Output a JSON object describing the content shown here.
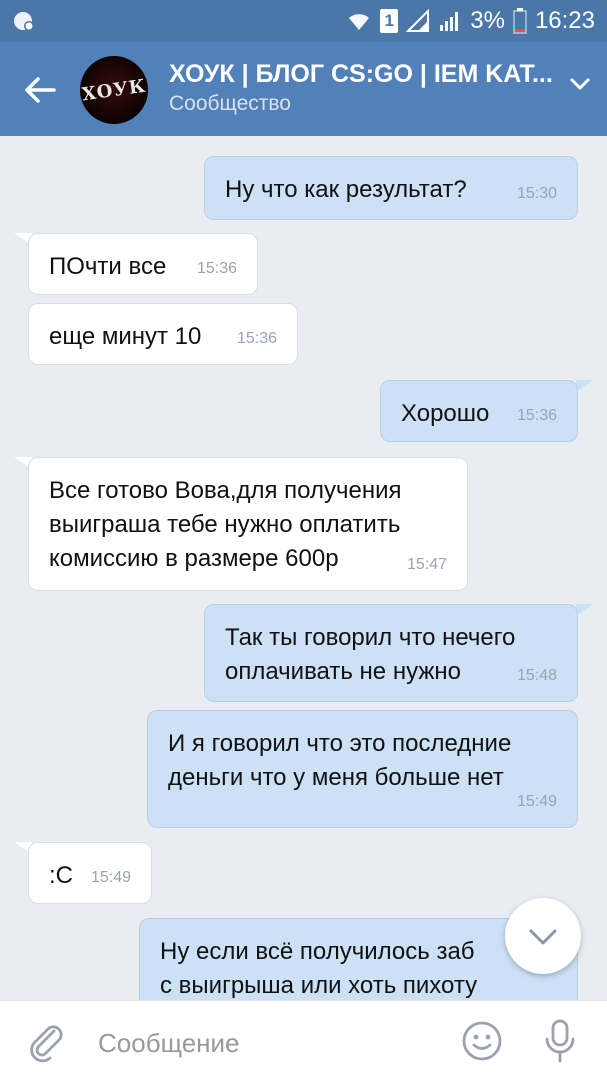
{
  "status_bar": {
    "sim_label": "1",
    "battery": "3%",
    "time": "16:23"
  },
  "header": {
    "title": "ХОУК | БЛОГ CS:GO | IEM KAT...",
    "subtitle": "Сообщество",
    "avatar_text": "ХОУК"
  },
  "messages": [
    {
      "dir": "out",
      "text": "Ну что как результат?",
      "time": "15:30"
    },
    {
      "dir": "in",
      "text": "ПОчти все",
      "time": "15:36"
    },
    {
      "dir": "in",
      "text": "еще минут 10",
      "time": "15:36"
    },
    {
      "dir": "out",
      "text": "Хорошо",
      "time": "15:36"
    },
    {
      "dir": "in",
      "lines": [
        "Все готово Вова,для получения",
        "выиграша тебе нужно оплатить",
        "комиссию в размере 600р"
      ],
      "time": "15:47"
    },
    {
      "dir": "out",
      "lines": [
        "Так ты говорил что нечего",
        "оплачивать не нужно"
      ],
      "time": "15:48"
    },
    {
      "dir": "out",
      "lines": [
        "И я говорил что это последние",
        "деньги что у меня больше нет"
      ],
      "time": "15:49"
    },
    {
      "dir": "in",
      "text": ":С",
      "time": "15:49"
    },
    {
      "dir": "out",
      "lines": [
        "Ну если всё получилось заб",
        "с выигрыша или хоть пихоту"
      ],
      "time": ""
    }
  ],
  "composer": {
    "placeholder": "Сообщение"
  },
  "icons": {
    "back": "back-arrow-icon",
    "chevron": "chevron-down-icon",
    "attach": "paperclip-icon",
    "emoji": "smiley-icon",
    "mic": "microphone-icon",
    "scroll": "chevron-down-icon"
  },
  "colors": {
    "header": "#5181b8",
    "statusbar": "#4a76a8",
    "chat_bg": "#e9edf2",
    "bubble_in": "#ffffff",
    "bubble_out": "#cce0f6"
  }
}
